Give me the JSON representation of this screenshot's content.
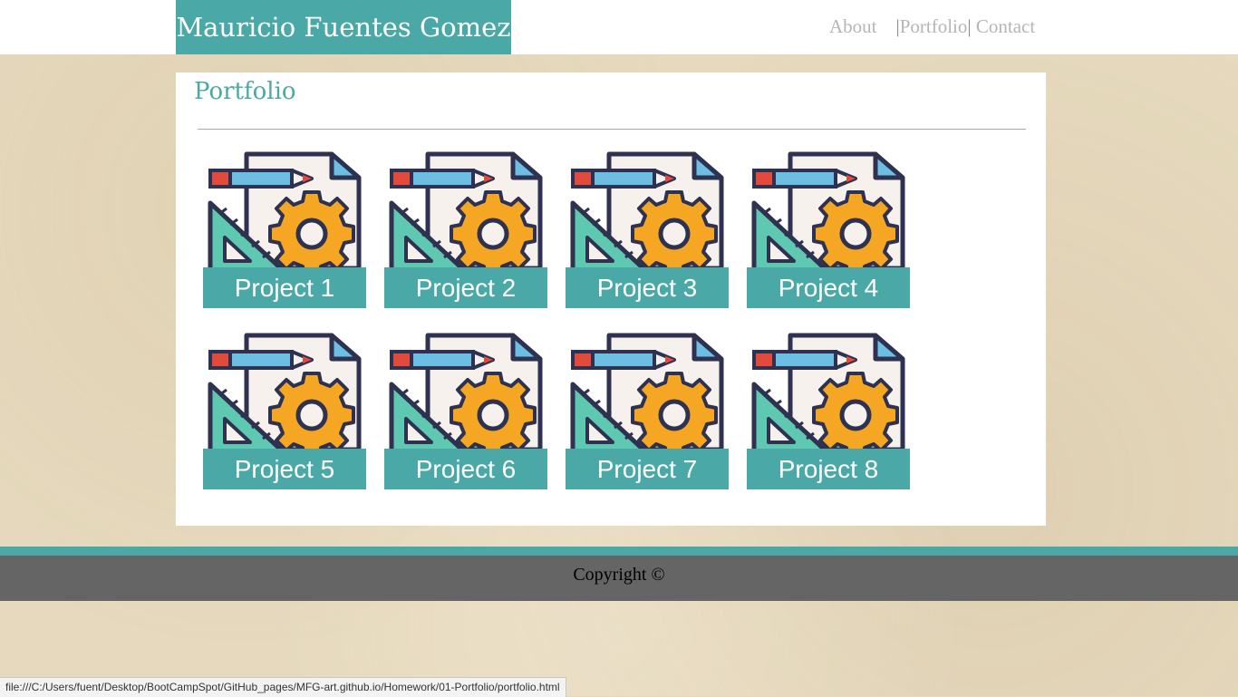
{
  "header": {
    "brand": "Mauricio Fuentes Gomez",
    "nav": {
      "about": "About",
      "sep1": "|",
      "portfolio": "Portfolio",
      "sep2": "|",
      "contact": "Contact"
    }
  },
  "main": {
    "title": "Portfolio",
    "projects": [
      {
        "label": "Project 1",
        "icon": "design-tools-icon"
      },
      {
        "label": "Project 2",
        "icon": "design-tools-icon"
      },
      {
        "label": "Project 3",
        "icon": "design-tools-icon"
      },
      {
        "label": "Project 4",
        "icon": "design-tools-icon"
      },
      {
        "label": "Project 5",
        "icon": "design-tools-icon"
      },
      {
        "label": "Project 6",
        "icon": "design-tools-icon"
      },
      {
        "label": "Project 7",
        "icon": "design-tools-icon"
      },
      {
        "label": "Project 8",
        "icon": "design-tools-icon"
      }
    ]
  },
  "footer": {
    "text": "Copyright ©"
  },
  "status_bar": {
    "url": "file:///C:/Users/fuent/Desktop/BootCampSpot/GitHub_pages/MFG-art.github.io/Homework/01-Portfolio/portfolio.html"
  },
  "colors": {
    "accent": "#4aa9a6",
    "footer_bg": "#656565",
    "page_bg": "#e6d9bd",
    "nav_text": "#b5b5b5"
  }
}
